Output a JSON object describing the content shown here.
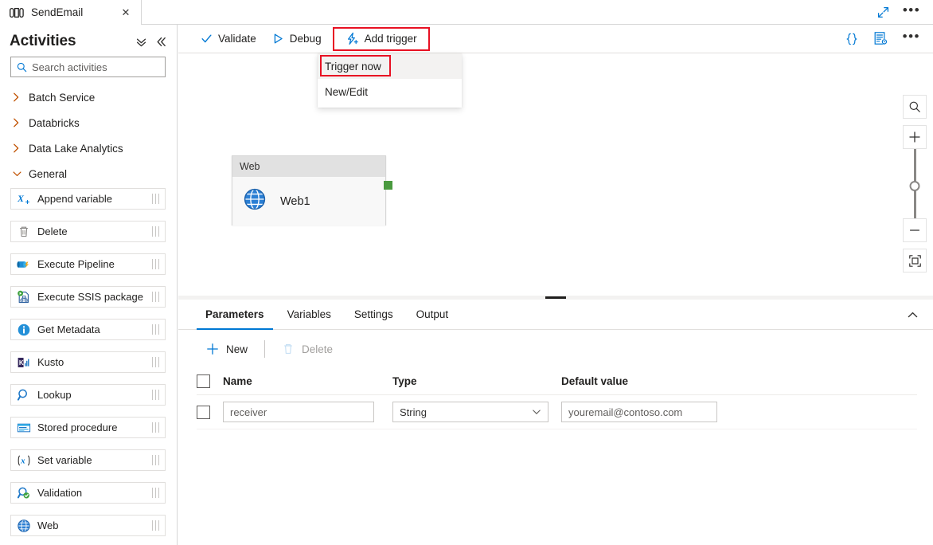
{
  "tab": {
    "label": "SendEmail",
    "icon": "pipeline-icon",
    "close_label": "✕"
  },
  "window_actions": {
    "expand_icon": "expand-diagonal-icon",
    "more_icon": "ellipsis-icon",
    "more_label": "•••"
  },
  "sidebar": {
    "title": "Activities",
    "collapse_all_icon": "double-chevron-down-icon",
    "collapse_panel_icon": "double-chevron-left-icon",
    "search": {
      "placeholder": "Search activities",
      "value": "",
      "icon": "search-icon"
    },
    "groups": [
      {
        "label": "Batch Service",
        "expanded": false
      },
      {
        "label": "Databricks",
        "expanded": false
      },
      {
        "label": "Data Lake Analytics",
        "expanded": false
      },
      {
        "label": "General",
        "expanded": true
      }
    ],
    "activities": [
      {
        "label": "Append variable",
        "icon": "append-variable-icon"
      },
      {
        "label": "Delete",
        "icon": "trash-icon"
      },
      {
        "label": "Execute Pipeline",
        "icon": "execute-pipeline-icon"
      },
      {
        "label": "Execute SSIS package",
        "icon": "ssis-package-icon"
      },
      {
        "label": "Get Metadata",
        "icon": "info-icon"
      },
      {
        "label": "Kusto",
        "icon": "kusto-icon"
      },
      {
        "label": "Lookup",
        "icon": "magnifier-icon"
      },
      {
        "label": "Stored procedure",
        "icon": "stored-procedure-icon"
      },
      {
        "label": "Set variable",
        "icon": "set-variable-icon"
      },
      {
        "label": "Validation",
        "icon": "validation-icon"
      },
      {
        "label": "Web",
        "icon": "globe-icon"
      }
    ]
  },
  "toolbar": {
    "validate_label": "Validate",
    "validate_icon": "checkmark-icon",
    "debug_label": "Debug",
    "debug_icon": "play-triangle-icon",
    "add_trigger_label": "Add trigger",
    "add_trigger_icon": "lightning-plus-icon",
    "code_icon": "curly-braces-icon",
    "code_label": "{ }",
    "properties_icon": "properties-gear-icon",
    "more_icon": "ellipsis-icon",
    "more_label": "•••"
  },
  "trigger_menu": {
    "items": [
      {
        "label": "Trigger now",
        "highlighted": true
      },
      {
        "label": "New/Edit",
        "highlighted": false
      }
    ]
  },
  "canvas": {
    "node": {
      "type_label": "Web",
      "name": "Web1",
      "icon": "globe-icon",
      "port_color": "#4a9a3f"
    },
    "controls": {
      "search_icon": "zoom-search-icon",
      "zoom_in_icon": "plus-icon",
      "zoom_out_icon": "minus-icon",
      "fit_icon": "fit-to-screen-icon"
    }
  },
  "bottom_panel": {
    "tabs": [
      {
        "label": "Parameters",
        "active": true
      },
      {
        "label": "Variables",
        "active": false
      },
      {
        "label": "Settings",
        "active": false
      },
      {
        "label": "Output",
        "active": false
      }
    ],
    "collapse_icon": "chevron-up-icon",
    "actions": {
      "new_label": "New",
      "new_icon": "plus-icon",
      "delete_label": "Delete",
      "delete_icon": "trash-icon",
      "delete_disabled": true
    },
    "table": {
      "headers": [
        "Name",
        "Type",
        "Default value"
      ],
      "rows": [
        {
          "selected": false,
          "name": "receiver",
          "type": "String",
          "default_value": "youremail@contoso.com"
        }
      ]
    }
  },
  "colors": {
    "accent": "#0078d4",
    "annotation": "#e81123",
    "port_green": "#4a9a3f",
    "chevron_orange": "#c05100"
  }
}
